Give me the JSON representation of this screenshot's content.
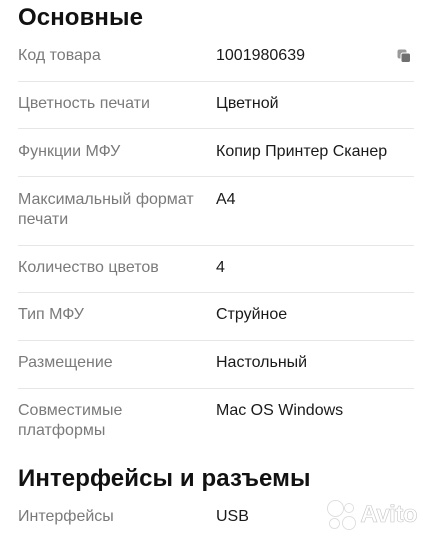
{
  "sections": [
    {
      "title": "Основные",
      "rows": [
        {
          "label": "Код товара",
          "value": "1001980639"
        },
        {
          "label": "Цветность печати",
          "value": "Цветной"
        },
        {
          "label": "Функции МФУ",
          "value": "Копир Принтер Сканер"
        },
        {
          "label": "Максимальный формат печати",
          "value": "А4"
        },
        {
          "label": "Количество цветов",
          "value": "4"
        },
        {
          "label": "Тип МФУ",
          "value": "Струйное"
        },
        {
          "label": "Размещение",
          "value": "Настольный"
        },
        {
          "label": "Совместимые платформы",
          "value": "Mac OS Windows"
        }
      ]
    },
    {
      "title": "Интерфейсы и разъемы",
      "rows": [
        {
          "label": "Интерфейсы",
          "value": "USB"
        }
      ]
    }
  ],
  "icons": {
    "copy": "copy-icon"
  },
  "watermark": {
    "text": "Avito"
  },
  "colors": {
    "label": "#7a7a7a",
    "value": "#1a1a1a",
    "divider": "#e6e6e6",
    "title": "#111111"
  }
}
